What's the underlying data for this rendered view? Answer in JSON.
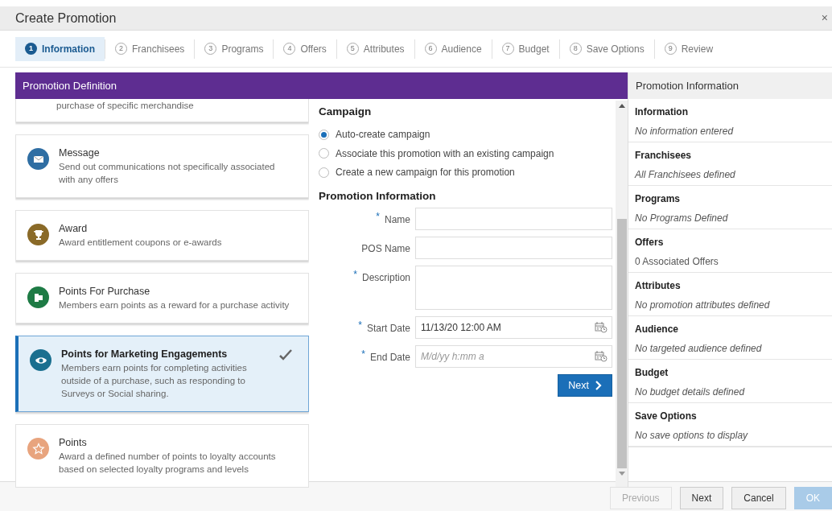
{
  "window": {
    "title": "Create Promotion",
    "close": "×"
  },
  "steps": [
    {
      "number": "1",
      "label": "Information",
      "selected": true
    },
    {
      "number": "2",
      "label": "Franchisees",
      "selected": false
    },
    {
      "number": "3",
      "label": "Programs",
      "selected": false
    },
    {
      "number": "4",
      "label": "Offers",
      "selected": false
    },
    {
      "number": "5",
      "label": "Attributes",
      "selected": false
    },
    {
      "number": "6",
      "label": "Audience",
      "selected": false
    },
    {
      "number": "7",
      "label": "Budget",
      "selected": false
    },
    {
      "number": "8",
      "label": "Save Options",
      "selected": false
    },
    {
      "number": "9",
      "label": "Review",
      "selected": false
    }
  ],
  "definition": {
    "title": "Promotion Definition",
    "cards": [
      {
        "description": "purchase of specific merchandise",
        "selected": false
      },
      {
        "kind": "mail",
        "color": "#2f6ea3",
        "title": "Message",
        "description": "Send out communications not specifically associated with any offers",
        "selected": false
      },
      {
        "kind": "trophy",
        "color": "#8a6a28",
        "title": "Award",
        "description": "Award entitlement coupons or e-awards",
        "selected": false
      },
      {
        "kind": "card",
        "color": "#1e7b45",
        "title": "Points For Purchase",
        "description": "Members earn points as a reward for a purchase activity",
        "selected": false
      },
      {
        "kind": "eye",
        "color": "#1a6f8f",
        "title": "Points for Marketing Engagements",
        "description": "Members earn points for completing activities outside of a purchase, such as responding to Surveys or Social sharing.",
        "selected": true
      },
      {
        "kind": "star",
        "color": "#e8a47e",
        "title": "Points",
        "description": "Award a defined number of points to loyalty accounts based on selected loyalty programs and levels",
        "selected": false
      }
    ]
  },
  "campaign": {
    "title": "Campaign",
    "options": [
      {
        "label": "Auto-create campaign",
        "selected": true
      },
      {
        "label": "Associate this promotion with an existing campaign",
        "selected": false
      },
      {
        "label": "Create a new campaign for this promotion",
        "selected": false
      }
    ]
  },
  "promotion_information": {
    "title": "Promotion Information",
    "fields": [
      {
        "kind": "text",
        "label": "Name",
        "required_mark": "*"
      },
      {
        "kind": "text",
        "label": "POS Name"
      },
      {
        "kind": "textarea",
        "label": "Description",
        "required_mark": "*"
      },
      {
        "kind": "date",
        "label": "Start Date",
        "required_mark": "*",
        "value": "11/13/20 12:00 AM"
      },
      {
        "kind": "date",
        "label": "End Date",
        "required_mark": "*",
        "placeholder": "M/d/yy h:mm a"
      }
    ],
    "next": "Next"
  },
  "summary": {
    "title": "Promotion Information",
    "sections": [
      {
        "title": "Information",
        "text": "No information entered",
        "italic": true
      },
      {
        "title": "Franchisees",
        "text": "All Franchisees defined",
        "italic": true
      },
      {
        "title": "Programs",
        "text": "No Programs Defined",
        "italic": true
      },
      {
        "title": "Offers",
        "text": "0 Associated Offers",
        "italic": false
      },
      {
        "title": "Attributes",
        "text": "No promotion attributes defined",
        "italic": true
      },
      {
        "title": "Audience",
        "text": "No targeted audience defined",
        "italic": true
      },
      {
        "title": "Budget",
        "text": "No budget details defined",
        "italic": true
      },
      {
        "title": "Save Options",
        "text": "No save options to display",
        "italic": true
      }
    ]
  },
  "footer": [
    {
      "label": "Previous",
      "disabled": true,
      "kind": "plain"
    },
    {
      "label": "Next",
      "disabled": false,
      "kind": "plain"
    },
    {
      "label": "Cancel",
      "disabled": false,
      "kind": "plain"
    },
    {
      "label": "OK",
      "disabled": true,
      "kind": "primary"
    }
  ]
}
